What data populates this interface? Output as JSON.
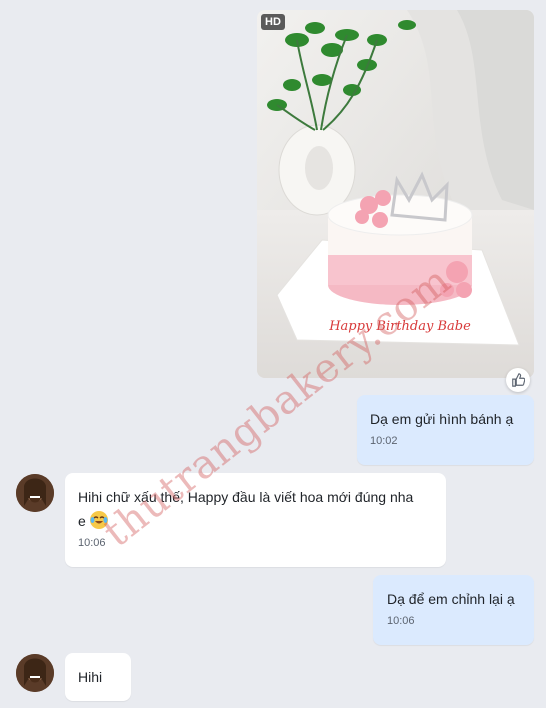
{
  "photo": {
    "badge": "HD",
    "cake_inscription": "Happy Birthday Babe"
  },
  "watermark": "thutrangbakery.com",
  "messages": [
    {
      "side": "out",
      "text": "Dạ em gửi hình bánh ạ",
      "time": "10:02"
    },
    {
      "side": "in",
      "text": "Hihi chữ xấu thế, Happy đầu là viết hoa mới đúng nha e",
      "emoji": "grinning-with-tears-emoji",
      "time": "10:06"
    },
    {
      "side": "out",
      "text": "Dạ để em chỉnh lại ạ",
      "time": "10:06"
    },
    {
      "side": "in",
      "text": "Hihi"
    }
  ],
  "icons": {
    "like": "thumbs-up-icon",
    "avatar": "contact-avatar"
  },
  "colors": {
    "outgoing_bubble": "#dbeafe",
    "incoming_bubble": "#ffffff",
    "background": "#e9ebf0"
  }
}
